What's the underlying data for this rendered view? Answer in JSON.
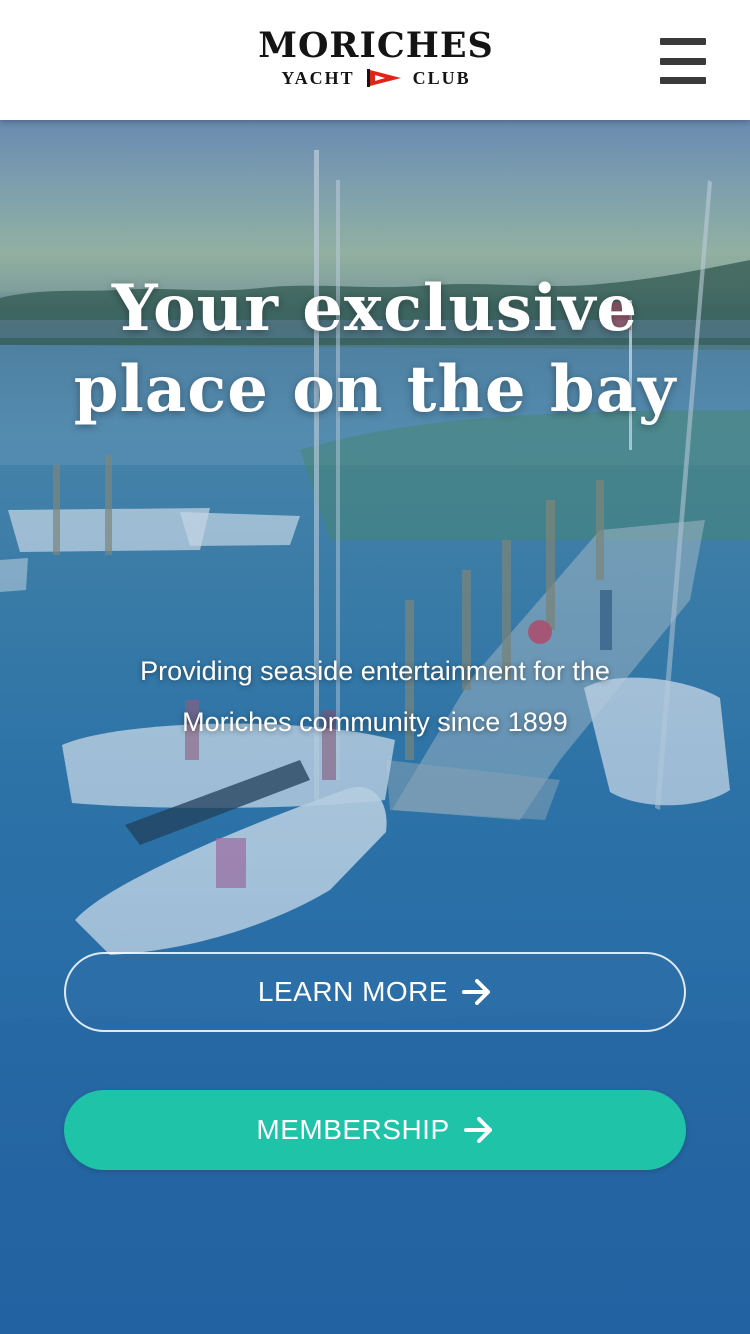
{
  "header": {
    "logo": {
      "line1": "MORICHES",
      "line2_left": "YACHT",
      "line2_right": "CLUB",
      "flag_icon": "burgee-flag-icon",
      "flag_color": "#e2231a"
    },
    "menu_icon": "hamburger-menu-icon"
  },
  "hero": {
    "title": "Your exclusive place on the bay",
    "subtitle": "Providing seaside entertainment for the Moriches community since 1899",
    "buttons": {
      "learn_more_label": "LEARN MORE",
      "membership_label": "MEMBERSHIP",
      "arrow_icon": "arrow-right-icon"
    }
  },
  "colors": {
    "accent": "#1fc3a8",
    "header_bg": "#ffffff",
    "logo_text": "#141414"
  }
}
